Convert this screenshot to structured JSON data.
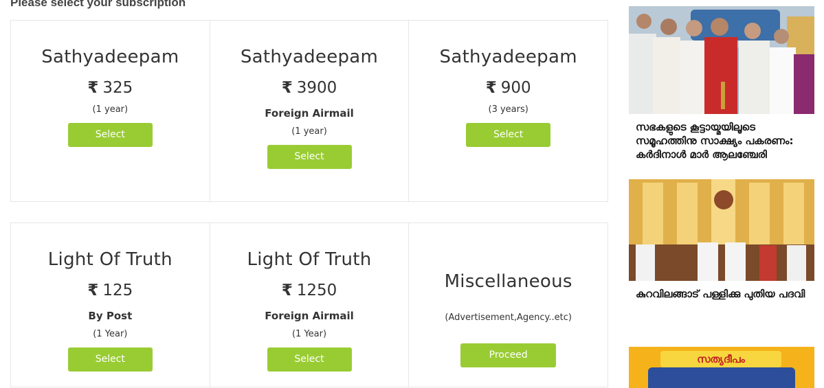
{
  "page": {
    "section_title": "Please select your subscription"
  },
  "subscriptions": [
    {
      "title": "Sathyadeepam",
      "currency": "₹",
      "price": "325",
      "mode": "",
      "duration": "(1 year)",
      "button": "Select"
    },
    {
      "title": "Sathyadeepam",
      "currency": "₹",
      "price": "3900",
      "mode": "Foreign Airmail",
      "duration": "(1 year)",
      "button": "Select"
    },
    {
      "title": "Sathyadeepam",
      "currency": "₹",
      "price": "900",
      "mode": "",
      "duration": "(3 years)",
      "button": "Select"
    },
    {
      "title": "Light Of Truth",
      "currency": "₹",
      "price": "125",
      "mode": "By Post",
      "duration": "(1 Year)",
      "button": "Select"
    },
    {
      "title": "Light Of Truth",
      "currency": "₹",
      "price": "1250",
      "mode": "Foreign Airmail",
      "duration": "(1 Year)",
      "button": "Select"
    }
  ],
  "misc": {
    "title": "Miscellaneous",
    "note": "(Advertisement,Agency..etc)",
    "button": "Proceed"
  },
  "sidebar": {
    "news": [
      {
        "title": "സഭകളുടെ കൂട്ടായ്മയിലൂടെ സമൂഹത്തിനു സാക്ഷ്യം പകരണം: കര്‍ദിനാള്‍ മാര്‍ ആലഞ്ചേരി"
      },
      {
        "title": "കുറവിലങ്ങാട് പള്ളിക്കു പുതിയ പദവി"
      }
    ],
    "ad_text": "സത്യദീപം"
  },
  "colors": {
    "button": "#99cc33",
    "border": "#e6e6e6",
    "ad_background": "#f5b21a"
  }
}
